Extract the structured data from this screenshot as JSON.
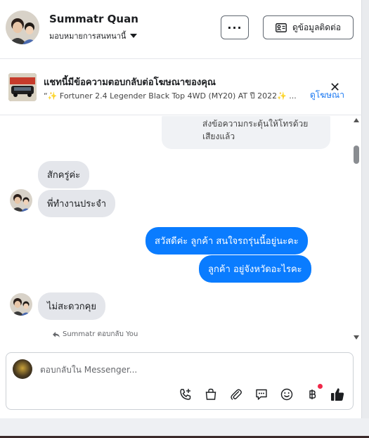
{
  "header": {
    "name": "Summatr Quan",
    "assign_label": "มอบหมายการสนทนานี้",
    "more_label": "···",
    "contact_label": "ดูข้อมูลติดต่อ"
  },
  "ad_banner": {
    "title": "แชทนี้มีข้อความตอบกลับต่อโฆษณาของคุณ",
    "subtitle": "“✨ Fortuner 2.4 Legender Black Top 4WD (MY20) AT ปี 2022✨ ...",
    "link_label": "ดูโฆษณา",
    "close_label": "✕"
  },
  "messages": {
    "system_line1": "ส่งข้อความกระตุ้นให้โทรด้วย",
    "system_line2": "เสียงแล้ว",
    "in_1": "สักครู่ค่ะ",
    "in_2": "พี่ทำงานประจำ",
    "out_1": "สวัสดีค่ะ  ลูกค้า  สนใจรถรุ่นนี้อยู่นะคะ",
    "out_2": "ลูกค้า   อยู่จังหวัดอะไรคะ",
    "in_3": "ไม่สะดวกคุย",
    "reply_note": "Summatr ตอบกลับ You"
  },
  "composer": {
    "placeholder": "ตอบกลับใน Messenger..."
  },
  "colors": {
    "accent": "#0a7cff",
    "link": "#1877f2",
    "incoming_bubble": "#e4e6eb",
    "badge": "#f02849"
  },
  "icons": [
    "contact-card-icon",
    "caret-down-icon",
    "close-icon",
    "reply-arrow-icon",
    "phone-plus-icon",
    "shopping-bag-icon",
    "paperclip-icon",
    "chat-bubble-icon",
    "smile-icon",
    "baht-icon",
    "thumbs-up-icon"
  ]
}
